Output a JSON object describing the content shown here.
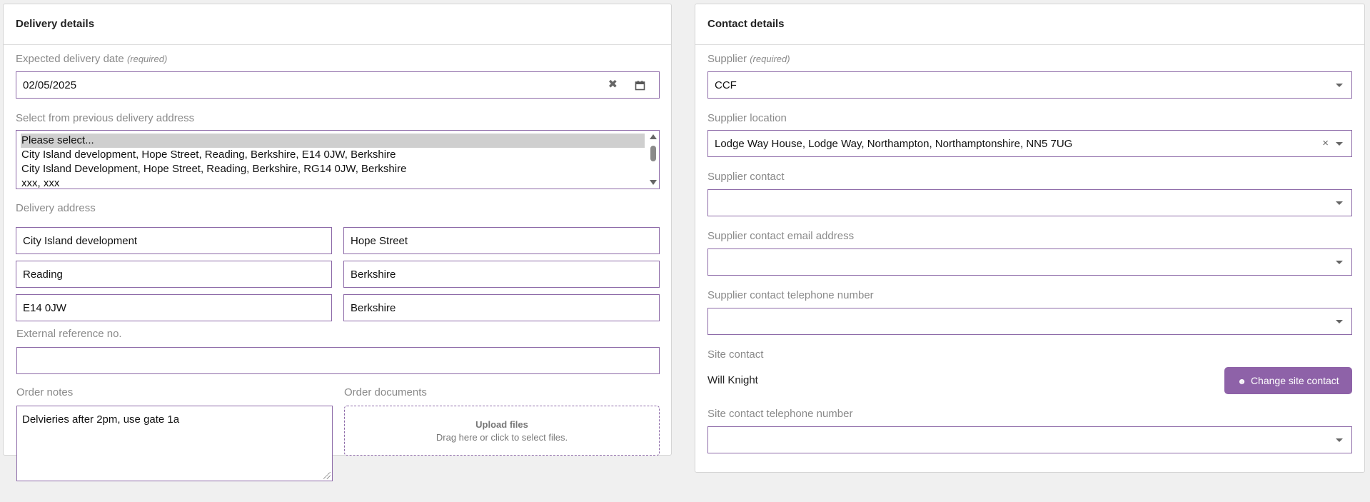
{
  "delivery": {
    "title": "Delivery details",
    "expected_date_label": "Expected delivery date",
    "required_text": "(required)",
    "expected_date_value": "02/05/2025",
    "prev_address_label": "Select from previous delivery address",
    "prev_address_options": [
      "Please select...",
      "City Island development, Hope Street, Reading, Berkshire, E14 0JW, Berkshire",
      "City Island Development, Hope Street, Reading, Berkshire, RG14 0JW, Berkshire",
      "xxx, xxx"
    ],
    "delivery_address_label": "Delivery address",
    "address_line1": "City Island development",
    "address_line2": "Hope Street",
    "town": "Reading",
    "county": "Berkshire",
    "postcode": "E14 0JW",
    "country": "Berkshire",
    "external_ref_label": "External reference no.",
    "external_ref_value": "",
    "order_notes_label": "Order notes",
    "order_notes_value": "Delvieries after 2pm, use gate 1a",
    "order_documents_label": "Order documents",
    "upload_title": "Upload files",
    "upload_hint": "Drag here or click to select files."
  },
  "contact": {
    "title": "Contact details",
    "supplier_label": "Supplier",
    "required_text": "(required)",
    "supplier_value": "CCF",
    "supplier_location_label": "Supplier location",
    "supplier_location_value": "Lodge Way House, Lodge Way, Northampton, Northamptonshire, NN5 7UG",
    "supplier_contact_label": "Supplier contact",
    "supplier_contact_value": "",
    "supplier_email_label": "Supplier contact email address",
    "supplier_email_value": "",
    "supplier_phone_label": "Supplier contact telephone number",
    "supplier_phone_value": "",
    "site_contact_label": "Site contact",
    "site_contact_name": "Will Knight",
    "change_site_contact_label": "Change site contact",
    "site_phone_label": "Site contact telephone number",
    "site_phone_value": ""
  },
  "colors": {
    "accent": "#8e62a8",
    "field_border": "#8d6aa8"
  }
}
